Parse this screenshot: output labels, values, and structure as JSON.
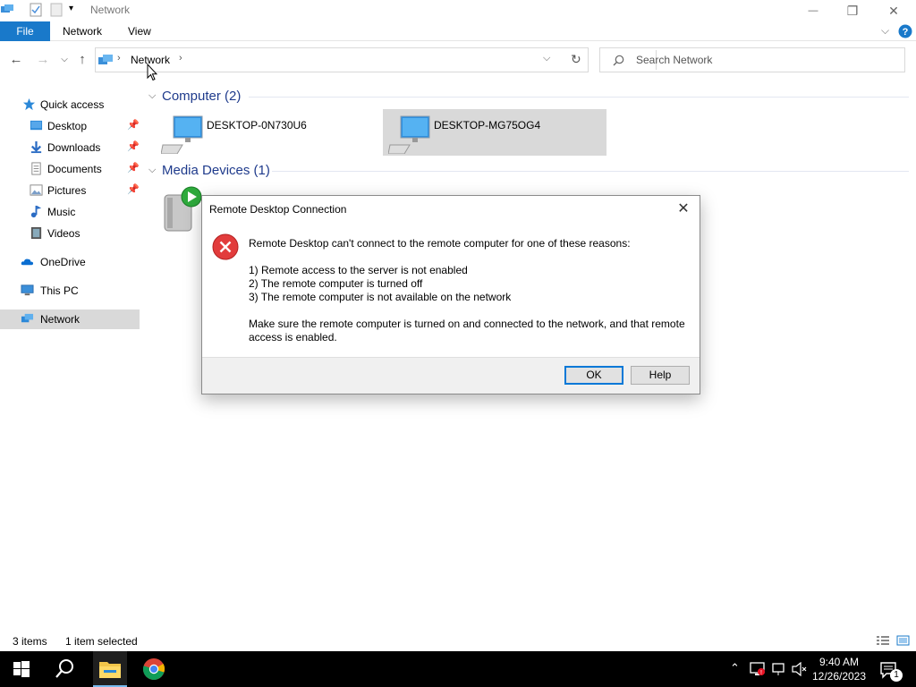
{
  "window": {
    "title": "Network",
    "controls": {
      "minimize": "—",
      "restore": "❐",
      "close": "✕"
    }
  },
  "ribbon": {
    "tabs": [
      "File",
      "Network",
      "View"
    ]
  },
  "address": {
    "crumbs": [
      "Network"
    ],
    "refresh_icon": "↻"
  },
  "search": {
    "placeholder": "Search Network"
  },
  "sidebar": {
    "items": [
      {
        "label": "Quick access",
        "icon": "star-icon"
      },
      {
        "label": "Desktop",
        "icon": "desktop-folder-icon",
        "pinned": true
      },
      {
        "label": "Downloads",
        "icon": "downloads-icon",
        "pinned": true
      },
      {
        "label": "Documents",
        "icon": "documents-icon",
        "pinned": true
      },
      {
        "label": "Pictures",
        "icon": "pictures-icon",
        "pinned": true
      },
      {
        "label": "Music",
        "icon": "music-icon"
      },
      {
        "label": "Videos",
        "icon": "videos-icon"
      },
      {
        "label": "OneDrive",
        "icon": "cloud-icon"
      },
      {
        "label": "This PC",
        "icon": "pc-icon"
      },
      {
        "label": "Network",
        "icon": "network-icon",
        "selected": true
      }
    ]
  },
  "groups": [
    {
      "title": "Computer (2)",
      "items": [
        "DESKTOP-0N730U6",
        "DESKTOP-MG75OG4"
      ]
    },
    {
      "title": "Media Devices (1)"
    }
  ],
  "dialog": {
    "title": "Remote Desktop Connection",
    "message": "Remote Desktop can't connect to the remote computer for one of these reasons:",
    "reasons": [
      "1) Remote access to the server is not enabled",
      "2) The remote computer is turned off",
      "3) The remote computer is not available on the network"
    ],
    "advice": "Make sure the remote computer is turned on and connected to the network, and that remote access is enabled.",
    "ok_label": "OK",
    "help_label": "Help"
  },
  "status": {
    "items": "3 items",
    "selected": "1 item selected"
  },
  "taskbar": {
    "time": "9:40 AM",
    "date": "12/26/2023",
    "notifications": "1"
  }
}
